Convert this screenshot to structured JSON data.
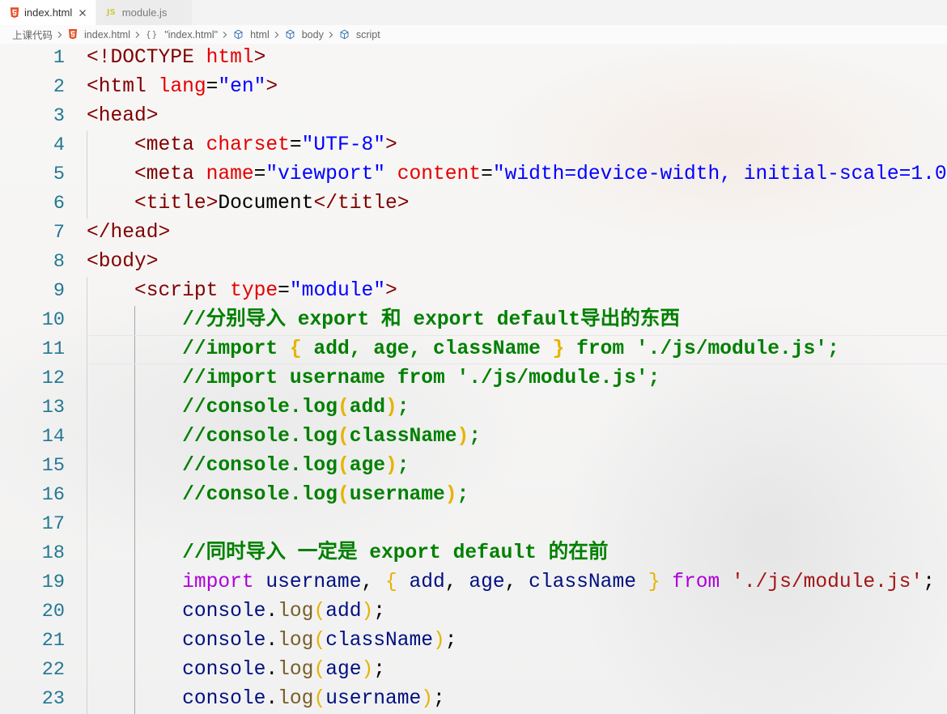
{
  "tabs": [
    {
      "label": "index.html",
      "icon": "html5-icon",
      "active": true
    },
    {
      "label": "module.js",
      "icon": "js-icon",
      "icon_text": "JS",
      "active": false
    }
  ],
  "breadcrumb": [
    {
      "label": "上课代码"
    },
    {
      "label": "index.html",
      "icon": "html5-icon"
    },
    {
      "label": "\"index.html\"",
      "icon": "braces-icon",
      "icon_text": "{}"
    },
    {
      "label": "html",
      "icon": "symbol-cube-icon"
    },
    {
      "label": "body",
      "icon": "symbol-cube-icon"
    },
    {
      "label": "script",
      "icon": "symbol-cube-icon"
    }
  ],
  "editor": {
    "current_line": 11,
    "lines": [
      {
        "n": 1,
        "tokens": [
          {
            "t": "<!DOCTYPE",
            "c": "#800000"
          },
          {
            "t": " html",
            "c": "#e50000"
          },
          {
            "t": ">",
            "c": "#800000"
          }
        ]
      },
      {
        "n": 2,
        "tokens": [
          {
            "t": "<html",
            "c": "#800000"
          },
          {
            "t": " lang",
            "c": "#e50000"
          },
          {
            "t": "=",
            "c": "#000000"
          },
          {
            "t": "\"en\"",
            "c": "#0000ff"
          },
          {
            "t": ">",
            "c": "#800000"
          }
        ]
      },
      {
        "n": 3,
        "tokens": [
          {
            "t": "<head>",
            "c": "#800000"
          }
        ]
      },
      {
        "n": 4,
        "tokens": [
          {
            "t": "    <meta",
            "c": "#800000"
          },
          {
            "t": " charset",
            "c": "#e50000"
          },
          {
            "t": "=",
            "c": "#000000"
          },
          {
            "t": "\"UTF-8\"",
            "c": "#0000ff"
          },
          {
            "t": ">",
            "c": "#800000"
          }
        ]
      },
      {
        "n": 5,
        "tokens": [
          {
            "t": "    <meta",
            "c": "#800000"
          },
          {
            "t": " name",
            "c": "#e50000"
          },
          {
            "t": "=",
            "c": "#000000"
          },
          {
            "t": "\"viewport\"",
            "c": "#0000ff"
          },
          {
            "t": " content",
            "c": "#e50000"
          },
          {
            "t": "=",
            "c": "#000000"
          },
          {
            "t": "\"width=device-width, initial-scale=1.0",
            "c": "#0000ff"
          }
        ]
      },
      {
        "n": 6,
        "tokens": [
          {
            "t": "    <title>",
            "c": "#800000"
          },
          {
            "t": "Document",
            "c": "#000000"
          },
          {
            "t": "</title>",
            "c": "#800000"
          }
        ]
      },
      {
        "n": 7,
        "tokens": [
          {
            "t": "</head>",
            "c": "#800000"
          }
        ]
      },
      {
        "n": 8,
        "tokens": [
          {
            "t": "<body>",
            "c": "#800000"
          }
        ]
      },
      {
        "n": 9,
        "tokens": [
          {
            "t": "    <script",
            "c": "#800000"
          },
          {
            "t": " type",
            "c": "#e50000"
          },
          {
            "t": "=",
            "c": "#000000"
          },
          {
            "t": "\"module\"",
            "c": "#0000ff"
          },
          {
            "t": ">",
            "c": "#800000"
          }
        ]
      },
      {
        "n": 10,
        "tokens": [
          {
            "t": "        //分别导入 export 和 export default导出的东西",
            "c": "#008000"
          }
        ]
      },
      {
        "n": 11,
        "tokens": [
          {
            "t": "        //import ",
            "c": "#008000"
          },
          {
            "t": "{",
            "c": "#e6b400"
          },
          {
            "t": " add, age, className ",
            "c": "#008000"
          },
          {
            "t": "}",
            "c": "#e6b400"
          },
          {
            "t": " from './js/module.js';",
            "c": "#008000"
          }
        ]
      },
      {
        "n": 12,
        "tokens": [
          {
            "t": "        //import username from './js/module.js';",
            "c": "#008000"
          }
        ]
      },
      {
        "n": 13,
        "tokens": [
          {
            "t": "        //console.log",
            "c": "#008000"
          },
          {
            "t": "(",
            "c": "#e6b400"
          },
          {
            "t": "add",
            "c": "#008000"
          },
          {
            "t": ")",
            "c": "#e6b400"
          },
          {
            "t": ";",
            "c": "#008000"
          }
        ]
      },
      {
        "n": 14,
        "tokens": [
          {
            "t": "        //console.log",
            "c": "#008000"
          },
          {
            "t": "(",
            "c": "#e6b400"
          },
          {
            "t": "className",
            "c": "#008000"
          },
          {
            "t": ")",
            "c": "#e6b400"
          },
          {
            "t": ";",
            "c": "#008000"
          }
        ]
      },
      {
        "n": 15,
        "tokens": [
          {
            "t": "        //console.log",
            "c": "#008000"
          },
          {
            "t": "(",
            "c": "#e6b400"
          },
          {
            "t": "age",
            "c": "#008000"
          },
          {
            "t": ")",
            "c": "#e6b400"
          },
          {
            "t": ";",
            "c": "#008000"
          }
        ]
      },
      {
        "n": 16,
        "tokens": [
          {
            "t": "        //console.log",
            "c": "#008000"
          },
          {
            "t": "(",
            "c": "#e6b400"
          },
          {
            "t": "username",
            "c": "#008000"
          },
          {
            "t": ")",
            "c": "#e6b400"
          },
          {
            "t": ";",
            "c": "#008000"
          }
        ]
      },
      {
        "n": 17,
        "tokens": []
      },
      {
        "n": 18,
        "tokens": [
          {
            "t": "        //同时导入 一定是 export default 的在前",
            "c": "#008000"
          }
        ]
      },
      {
        "n": 19,
        "tokens": [
          {
            "t": "        import",
            "c": "#af00db"
          },
          {
            "t": " username",
            "c": "#001080"
          },
          {
            "t": ",",
            "c": "#000000"
          },
          {
            "t": " {",
            "c": "#e6b400"
          },
          {
            "t": " add",
            "c": "#001080"
          },
          {
            "t": ",",
            "c": "#000000"
          },
          {
            "t": " age",
            "c": "#001080"
          },
          {
            "t": ",",
            "c": "#000000"
          },
          {
            "t": " className",
            "c": "#001080"
          },
          {
            "t": " }",
            "c": "#e6b400"
          },
          {
            "t": " from",
            "c": "#af00db"
          },
          {
            "t": " './js/module.js'",
            "c": "#a31515"
          },
          {
            "t": ";",
            "c": "#000000"
          }
        ]
      },
      {
        "n": 20,
        "tokens": [
          {
            "t": "        console",
            "c": "#001080"
          },
          {
            "t": ".",
            "c": "#000000"
          },
          {
            "t": "log",
            "c": "#795e26"
          },
          {
            "t": "(",
            "c": "#e6b400"
          },
          {
            "t": "add",
            "c": "#001080"
          },
          {
            "t": ")",
            "c": "#e6b400"
          },
          {
            "t": ";",
            "c": "#000000"
          }
        ]
      },
      {
        "n": 21,
        "tokens": [
          {
            "t": "        console",
            "c": "#001080"
          },
          {
            "t": ".",
            "c": "#000000"
          },
          {
            "t": "log",
            "c": "#795e26"
          },
          {
            "t": "(",
            "c": "#e6b400"
          },
          {
            "t": "className",
            "c": "#001080"
          },
          {
            "t": ")",
            "c": "#e6b400"
          },
          {
            "t": ";",
            "c": "#000000"
          }
        ]
      },
      {
        "n": 22,
        "tokens": [
          {
            "t": "        console",
            "c": "#001080"
          },
          {
            "t": ".",
            "c": "#000000"
          },
          {
            "t": "log",
            "c": "#795e26"
          },
          {
            "t": "(",
            "c": "#e6b400"
          },
          {
            "t": "age",
            "c": "#001080"
          },
          {
            "t": ")",
            "c": "#e6b400"
          },
          {
            "t": ";",
            "c": "#000000"
          }
        ]
      },
      {
        "n": 23,
        "tokens": [
          {
            "t": "        console",
            "c": "#001080"
          },
          {
            "t": ".",
            "c": "#000000"
          },
          {
            "t": "log",
            "c": "#795e26"
          },
          {
            "t": "(",
            "c": "#e6b400"
          },
          {
            "t": "username",
            "c": "#001080"
          },
          {
            "t": ")",
            "c": "#e6b400"
          },
          {
            "t": ";",
            "c": "#000000"
          }
        ]
      }
    ]
  }
}
